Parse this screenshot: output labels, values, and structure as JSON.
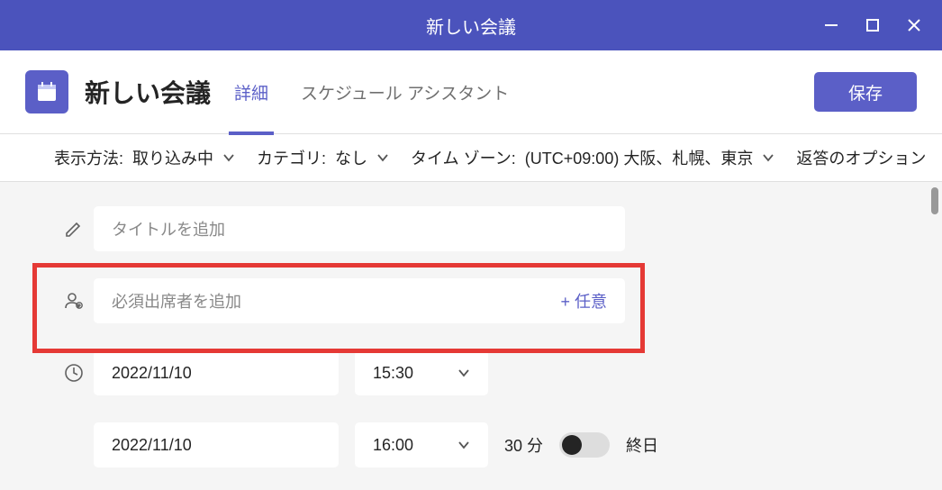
{
  "titlebar": {
    "text": "新しい会議"
  },
  "header": {
    "title": "新しい会議",
    "tabs": {
      "detail": "詳細",
      "assistant": "スケジュール アシスタント"
    },
    "save": "保存"
  },
  "optbar": {
    "show_as_label": "表示方法:",
    "show_as_value": "取り込み中",
    "category_label": "カテゴリ:",
    "category_value": "なし",
    "timezone_label": "タイム ゾーン:",
    "timezone_value": "(UTC+09:00) 大阪、札幌、東京",
    "response_options": "返答のオプション"
  },
  "form": {
    "title_placeholder": "タイトルを追加",
    "attendee_placeholder": "必須出席者を追加",
    "optional_link": "+ 任意",
    "start_date": "2022/11/10",
    "start_time": "15:30",
    "end_date": "2022/11/10",
    "end_time": "16:00",
    "duration": "30 分",
    "allday": "終日"
  }
}
